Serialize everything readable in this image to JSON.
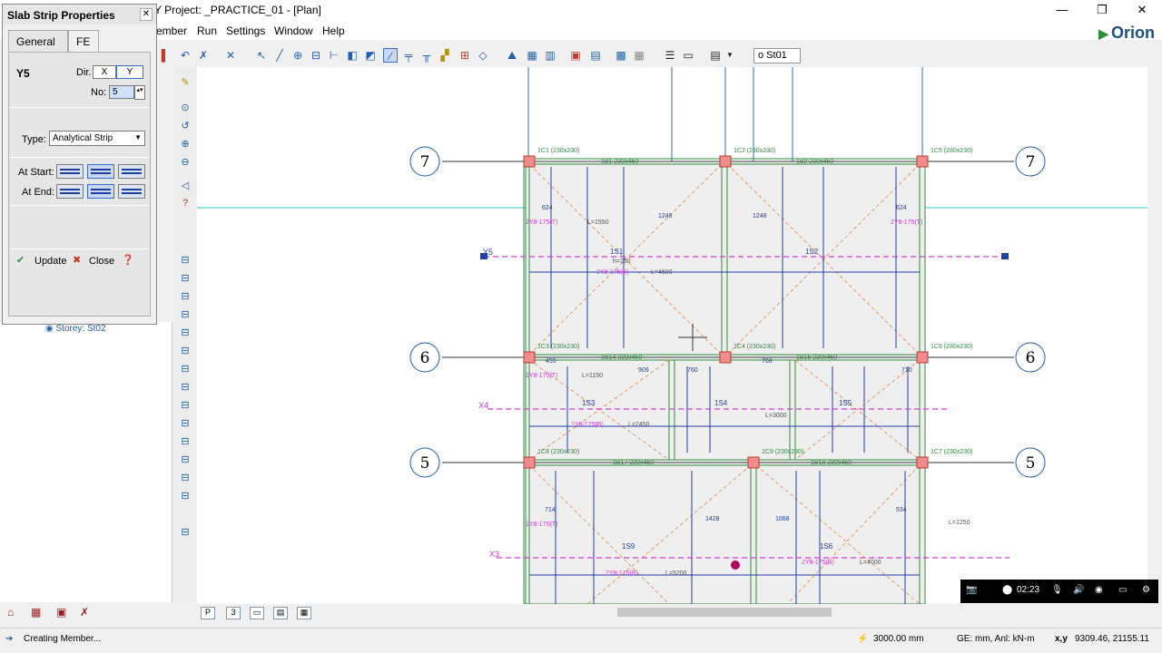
{
  "window": {
    "title": "Y Project: _PRACTICE_01 - [Plan]",
    "controls": [
      "—",
      "❐",
      "✕"
    ]
  },
  "menu": {
    "items": [
      "ember",
      "Run",
      "Settings",
      "Window",
      "Help"
    ]
  },
  "brand": {
    "name": "Orion",
    "color": "#1d4f79"
  },
  "toolbar": {
    "storey": "o St01"
  },
  "dialog": {
    "title": "Slab Strip Properties",
    "close": "✕",
    "tabs": [
      "General",
      "FE"
    ],
    "strip_name": "Y5",
    "dir_label": "Dir.",
    "dir_x": "X",
    "dir_y": "Y",
    "no_label": "No:",
    "no_value": "5",
    "type_label": "Type:",
    "type_value": "Analytical Strip",
    "at_start": "At Start:",
    "at_end": "At End:",
    "update": "Update",
    "close_btn": "Close"
  },
  "tree": {
    "storey_node": "Storey: St02"
  },
  "status": {
    "message": "Creating Member...",
    "length": "3000.00 mm",
    "units": "GE: mm, Anl: kN-m",
    "coord_label": "x,y",
    "coords": "9309.46, 21155.11"
  },
  "recorder": {
    "time": "02:23"
  },
  "plan": {
    "grid_bubbles_left": [
      "7",
      "6",
      "5"
    ],
    "grid_bubbles_right": [
      "7",
      "6",
      "5"
    ],
    "strips": [
      "Y5",
      "X4",
      "X3"
    ],
    "columns": [
      "1C1 (230x230)",
      "1C2 (230x230)",
      "1C5 (230x230)",
      "1C3 (230x230)",
      "1C4 (230x230)",
      "1C6 (230x230)",
      "1C8 (230x230)",
      "1C9 (230x230)",
      "1C7 (230x230)"
    ],
    "beams": [
      "1B1 230x450",
      "1B2 230x450",
      "1B14 230x450",
      "1B15 230x450",
      "1B17 230x450",
      "1B18 230x450"
    ],
    "slabs": [
      "1S1",
      "1S2",
      "1S3",
      "1S4",
      "1S5",
      "1S9",
      "1S6"
    ],
    "rebar_labels": [
      "2Y8-175(T)",
      "2Y8-175(B)",
      "1Y8-175(T)",
      "1Y8-175(B)",
      "h=150",
      "L=1550",
      "L=4600",
      "L=2450",
      "L=3000",
      "L=1150",
      "L=5200",
      "L=4000",
      "L=1250"
    ],
    "dims": [
      "624",
      "1248",
      "1248",
      "624",
      "455",
      "909",
      "760",
      "768",
      "710",
      "714",
      "1428",
      "1068",
      "534"
    ]
  }
}
